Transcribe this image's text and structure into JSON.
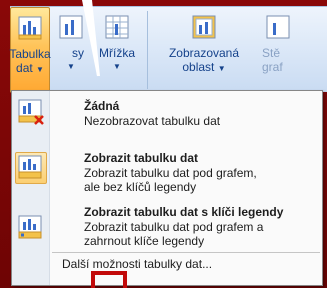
{
  "ribbon": {
    "buttons": [
      {
        "name": "data-table",
        "label_line1": "Tabulka",
        "label_line2": "dat",
        "has_arrow": true,
        "active": true
      },
      {
        "name": "axes",
        "label_line1": "sy",
        "label_line2": "",
        "has_arrow": true,
        "active": false
      },
      {
        "name": "gridlines",
        "label_line1": "Mřížka",
        "label_line2": "",
        "has_arrow": true,
        "active": false
      },
      {
        "name": "plot-area",
        "label_line1": "Zobrazovaná",
        "label_line2": "oblast",
        "has_arrow": true,
        "active": false
      },
      {
        "name": "chart-wall",
        "label_line1": "Stě",
        "label_line2": "graf",
        "has_arrow": false,
        "active": false
      }
    ]
  },
  "menu": {
    "items": [
      {
        "title": "Žádná",
        "desc_line1": "Nezobrazovat tabulku dat",
        "desc_line2": ""
      },
      {
        "title": "Zobrazit tabulku dat",
        "desc_line1": "Zobrazit tabulku dat pod grafem,",
        "desc_line2": "ale bez klíčů legendy"
      },
      {
        "title": "Zobrazit tabulku dat s klíči legendy",
        "desc_line1": "Zobrazit tabulku dat pod grafem a",
        "desc_line2": "zahrnout klíče legendy"
      }
    ],
    "more_options": "Další možnosti tabulky dat..."
  },
  "colors": {
    "frame": "#7a0606",
    "highlight": "#ffc45a",
    "annotation": "#c20a0a",
    "text": "#15428b"
  }
}
